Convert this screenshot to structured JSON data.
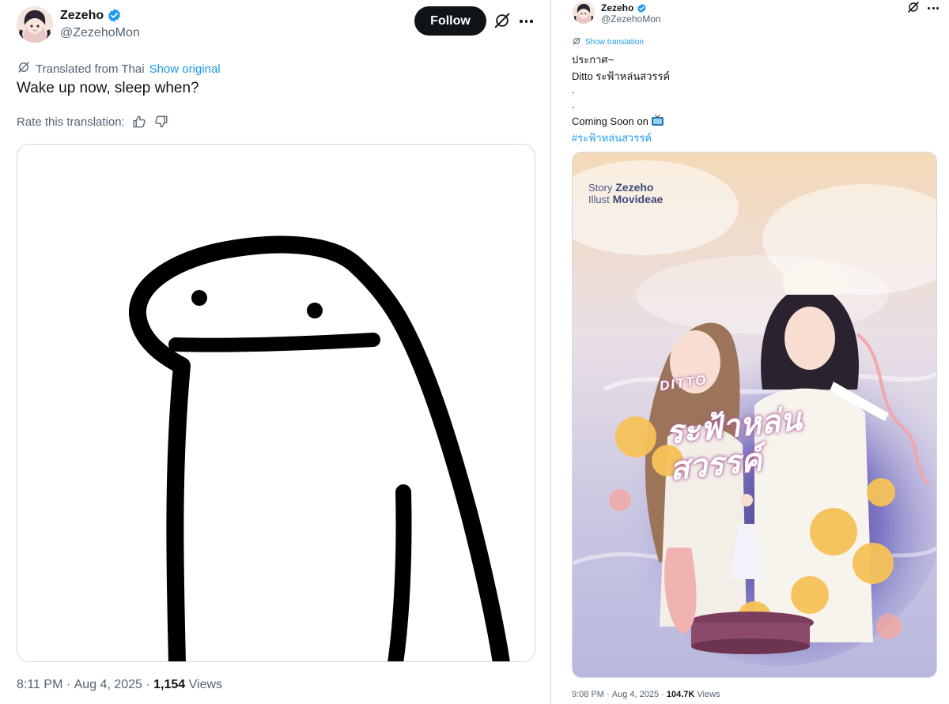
{
  "left_tweet": {
    "author": {
      "name": "Zezeho",
      "handle": "@ZezehoMon"
    },
    "follow_label": "Follow",
    "translated_from": "Translated from Thai",
    "show_original": "Show original",
    "text": "Wake up now, sleep when?",
    "rate_label": "Rate this translation:",
    "meta": {
      "time": "8:11 PM",
      "sep1": " · ",
      "date": "Aug 4, 2025",
      "sep2": " · ",
      "views_count": "1,154",
      "views_label": " Views"
    }
  },
  "right_tweet": {
    "author": {
      "name": "Zezeho",
      "handle": "@ZezehoMon"
    },
    "show_translation": "Show translation",
    "lines": [
      "ประกาศ~",
      "Ditto ระฟ้าหล่นสวรรค์",
      ".",
      ".",
      "Coming Soon on"
    ],
    "hashtag": "#ระฟ้าหล่นสวรรค์",
    "poster": {
      "story_label": "Story",
      "story_name": "Zezeho",
      "illust_label": "Illust",
      "illust_name": "Movideae",
      "title_small": "DITTO",
      "title_big": "ระฟ้าหล่นสวรรค์"
    },
    "meta": {
      "time": "9:08 PM",
      "sep1": " · ",
      "date": "Aug 4, 2025",
      "sep2": " · ",
      "views_count": "104.7K",
      "views_label": " Views"
    }
  },
  "colors": {
    "link": "#1d9bf0",
    "text": "#0f1419",
    "muted": "#536471",
    "border": "#cfd9de",
    "verified": "#1d9bf0"
  },
  "icons": [
    "verified-badge-icon",
    "grok-icon",
    "more-icon",
    "translate-icon",
    "thumbs-up-icon",
    "thumbs-down-icon",
    "tv-icon"
  ]
}
